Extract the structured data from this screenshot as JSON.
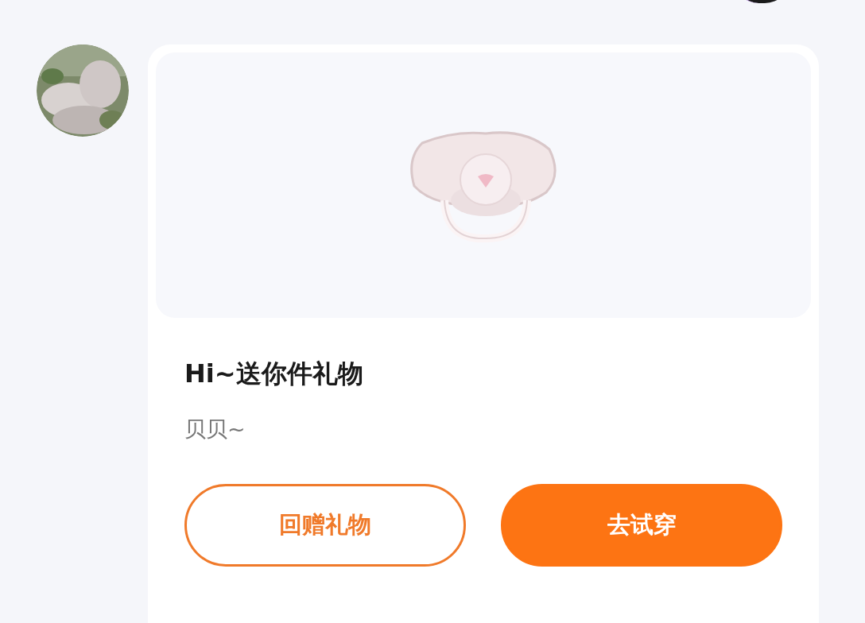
{
  "message": {
    "title": "Hi~送你件礼物",
    "subtitle": "贝贝~",
    "buttons": [
      {
        "label": "回赠礼物",
        "kind": "outline"
      },
      {
        "label": "去试穿",
        "kind": "filled"
      }
    ]
  }
}
